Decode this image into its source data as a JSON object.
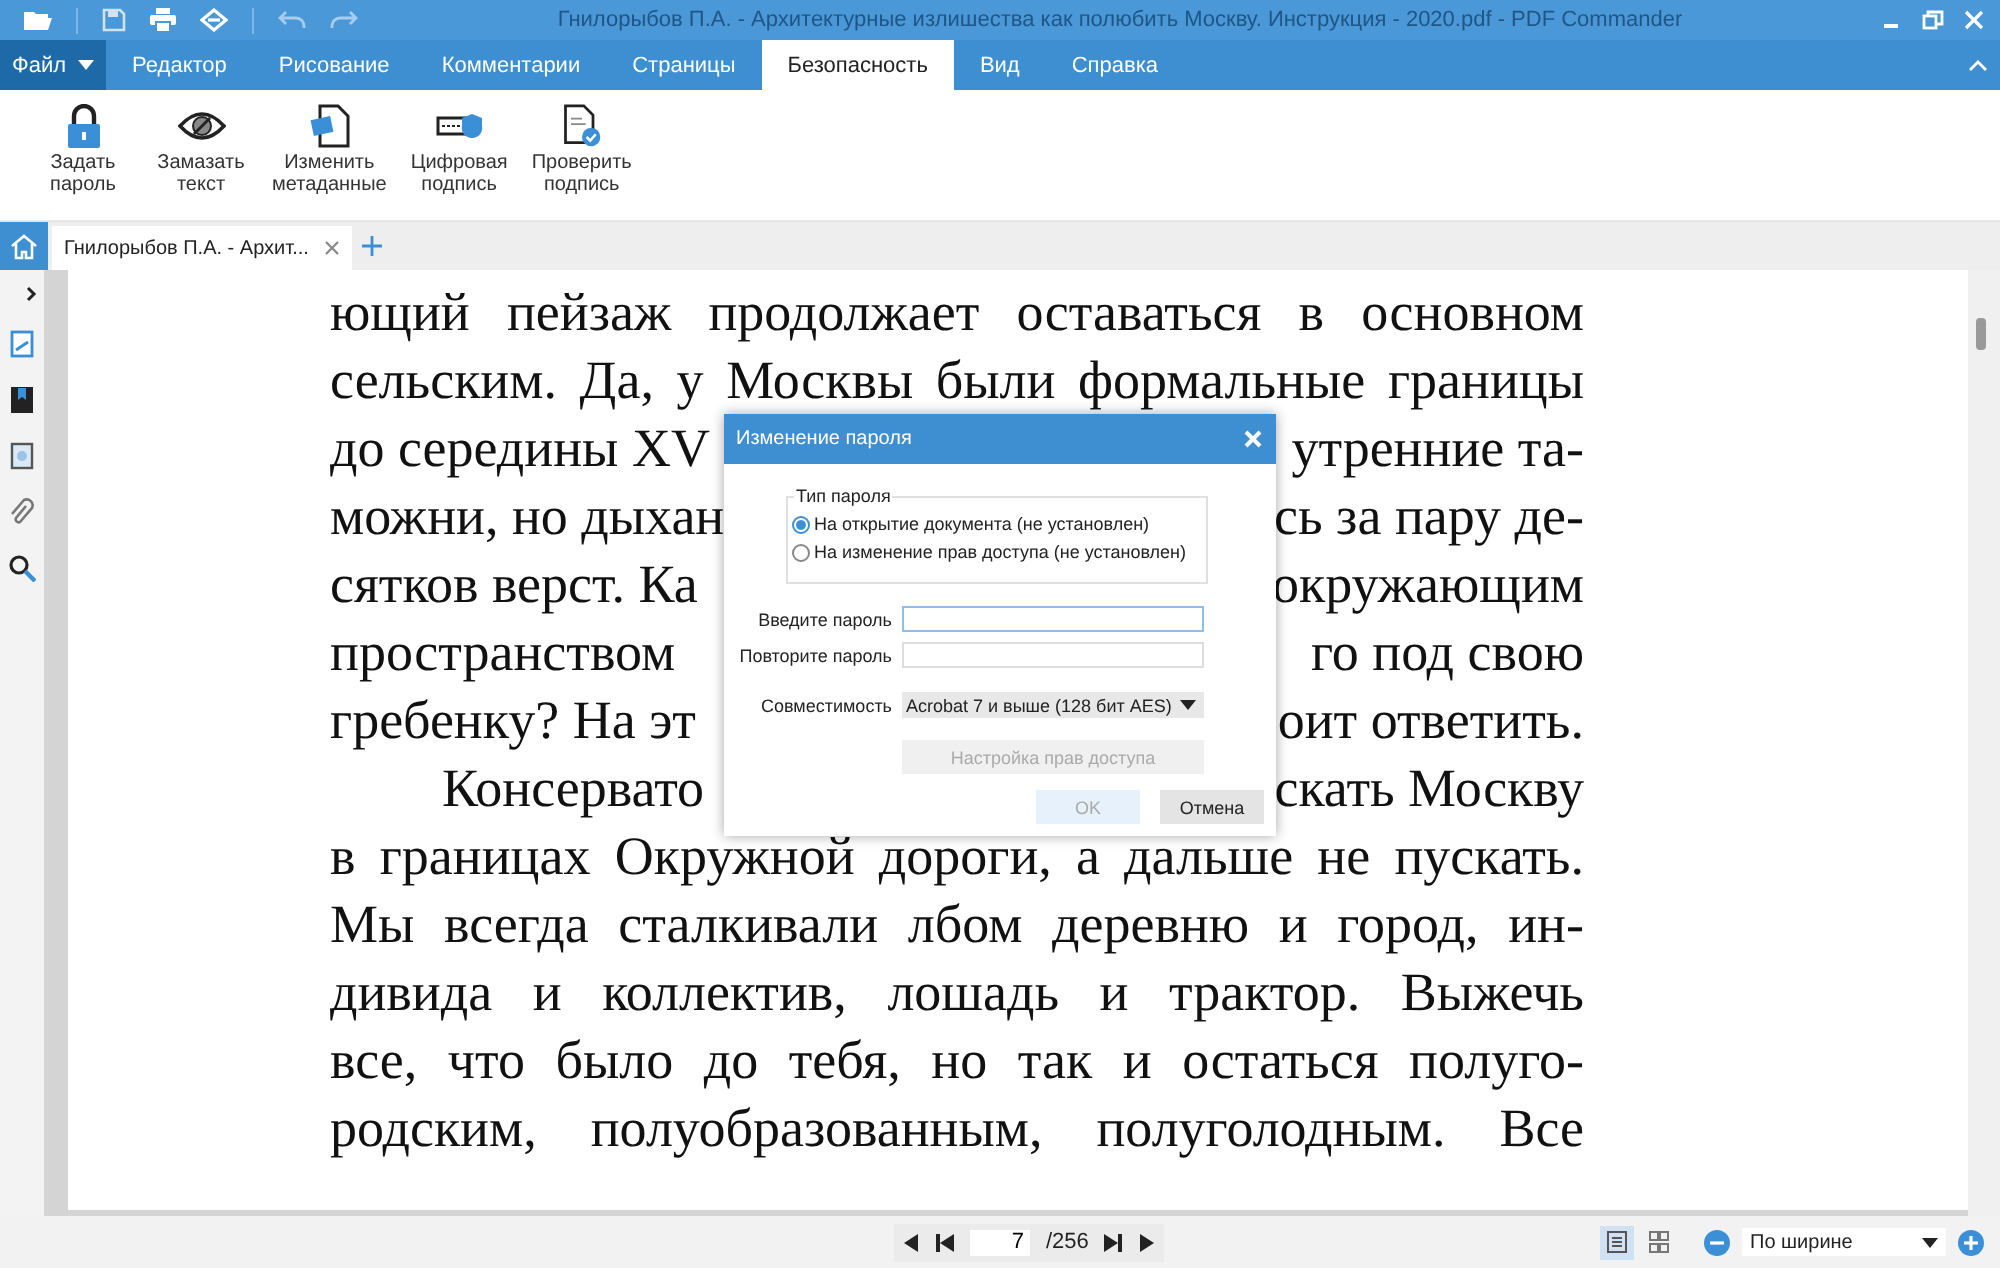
{
  "window": {
    "title": "Гнилорыбов П.А. - Архитектурные излишества как полюбить Москву. Инструкция - 2020.pdf - PDF Commander"
  },
  "menu": {
    "file": "Файл",
    "tabs": [
      {
        "label": "Редактор",
        "selected": false
      },
      {
        "label": "Рисование",
        "selected": false
      },
      {
        "label": "Комментарии",
        "selected": false
      },
      {
        "label": "Страницы",
        "selected": false
      },
      {
        "label": "Безопасность",
        "selected": true
      },
      {
        "label": "Вид",
        "selected": false
      },
      {
        "label": "Справка",
        "selected": false
      }
    ]
  },
  "ribbon": [
    {
      "kind": "lock",
      "lines": [
        "Задать",
        "пароль"
      ]
    },
    {
      "kind": "eye",
      "lines": [
        "Замазать",
        "текст"
      ]
    },
    {
      "kind": "meta",
      "lines": [
        "Изменить",
        "метаданные"
      ]
    },
    {
      "kind": "sign",
      "lines": [
        "Цифровая",
        "подпись"
      ]
    },
    {
      "kind": "verify",
      "lines": [
        "Проверить",
        "подпись"
      ]
    }
  ],
  "doc_tabs": [
    {
      "label": "Гнилорыбов П.А. - Архит...",
      "selected": true
    }
  ],
  "page": {
    "lines": [
      {
        "kind": "full",
        "text": "ющий пейзаж продолжает оставаться в основном"
      },
      {
        "kind": "full",
        "text": "сельским. Да, у Москвы были формальные границы"
      },
      {
        "kind": "split",
        "left": "до середины XV",
        "right": "утренние та-"
      },
      {
        "kind": "split",
        "left": "можни, но дыхан",
        "right": "сь за пару де-"
      },
      {
        "kind": "split",
        "left": "сятков верст. Ка",
        "right": "окружающим"
      },
      {
        "kind": "split",
        "left": "пространством",
        "right": "го под свою"
      },
      {
        "kind": "split",
        "left": "гребенку? На эт",
        "right": "оит ответить."
      },
      {
        "kind": "split",
        "left": "Консервато",
        "right": "скать Москву",
        "indent": true
      },
      {
        "kind": "full",
        "text": "в границах Окружной дороги, а дальше не пускать."
      },
      {
        "kind": "full",
        "text": "Мы всегда сталкивали лбом деревню и город, ин-"
      },
      {
        "kind": "full",
        "text": "дивида и коллектив, лошадь и трактор. Выжечь"
      },
      {
        "kind": "full",
        "text": "все, что было до тебя, но так и остаться полуго-"
      },
      {
        "kind": "full",
        "text": "родским, полуобразованным, полуголодным. Все"
      }
    ]
  },
  "dialog": {
    "title": "Изменение пароля",
    "group_label": "Тип пароля",
    "options": [
      {
        "label": "На открытие документа (не установлен)",
        "selected": true
      },
      {
        "label": "На изменение прав доступа (не установлен)",
        "selected": false
      }
    ],
    "fields": [
      {
        "label": "Введите пароль",
        "focused": true
      },
      {
        "label": "Повторите пароль",
        "focused": false
      }
    ],
    "compat_label": "Совместимость",
    "compat_value": "Acrobat 7 и выше (128 бит AES)",
    "permissions_button": {
      "label": "Настройка прав доступа",
      "disabled": true
    },
    "ok": {
      "label": "OK",
      "disabled": true
    },
    "cancel": {
      "label": "Отмена",
      "disabled": false
    }
  },
  "status": {
    "page": "7",
    "total": "/256",
    "zoom": "По ширине",
    "view_modes": [
      {
        "kind": "single",
        "selected": true
      },
      {
        "kind": "grid",
        "selected": false
      }
    ]
  }
}
